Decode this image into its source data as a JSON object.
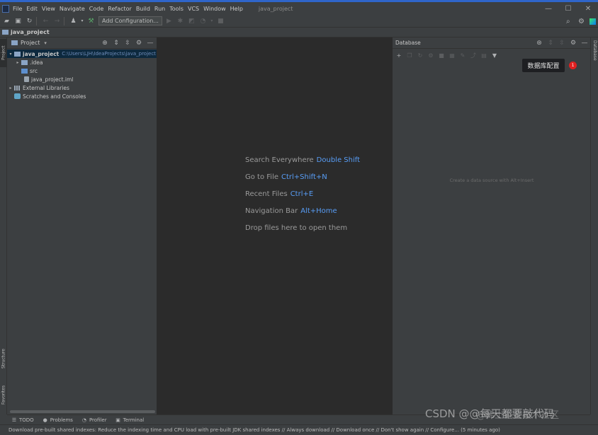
{
  "window": {
    "menu": [
      "File",
      "Edit",
      "View",
      "Navigate",
      "Code",
      "Refactor",
      "Build",
      "Run",
      "Tools",
      "VCS",
      "Window",
      "Help"
    ],
    "title": "java_project",
    "controls": {
      "minimize": "—",
      "maximize": "☐",
      "close": "✕"
    }
  },
  "toolbar": {
    "add_configuration": "Add Configuration..."
  },
  "breadcrumb": {
    "project": "java_project"
  },
  "left_strip": {
    "project": "Project",
    "structure": "Structure",
    "favorites": "Favorites"
  },
  "right_strip": {
    "database": "Database"
  },
  "project_panel": {
    "title": "Project",
    "tree": {
      "root": {
        "label": "java_project",
        "path": "C:\\Users\\LJH\\IdeaProjects\\java_project"
      },
      "idea": ".idea",
      "src": "src",
      "iml": "java_project.iml",
      "external": "External Libraries",
      "scratches": "Scratches and Consoles"
    }
  },
  "editor": {
    "hints": [
      {
        "label": "Search Everywhere",
        "key": "Double Shift"
      },
      {
        "label": "Go to File",
        "key": "Ctrl+Shift+N"
      },
      {
        "label": "Recent Files",
        "key": "Ctrl+E"
      },
      {
        "label": "Navigation Bar",
        "key": "Alt+Home"
      },
      {
        "label": "Drop files here to open them",
        "key": ""
      }
    ]
  },
  "database_panel": {
    "title": "Database",
    "empty_text": "Create a data source with Alt+Insert",
    "tooltip": "数据库配置",
    "badge": "1"
  },
  "bottom_tabs": {
    "todo": "TODO",
    "problems": "Problems",
    "profiler": "Profiler",
    "terminal": "Terminal"
  },
  "status": {
    "message": "Download pre-built shared indexes: Reduce the indexing time and CPU load with pre-built JDK shared indexes // Always download // Download once // Don't show again // Configure... (5 minutes ago)"
  },
  "watermark": {
    "main": "CSDN @@每天都要敲代码",
    "secondary": "@稀土掘金技术社区"
  }
}
